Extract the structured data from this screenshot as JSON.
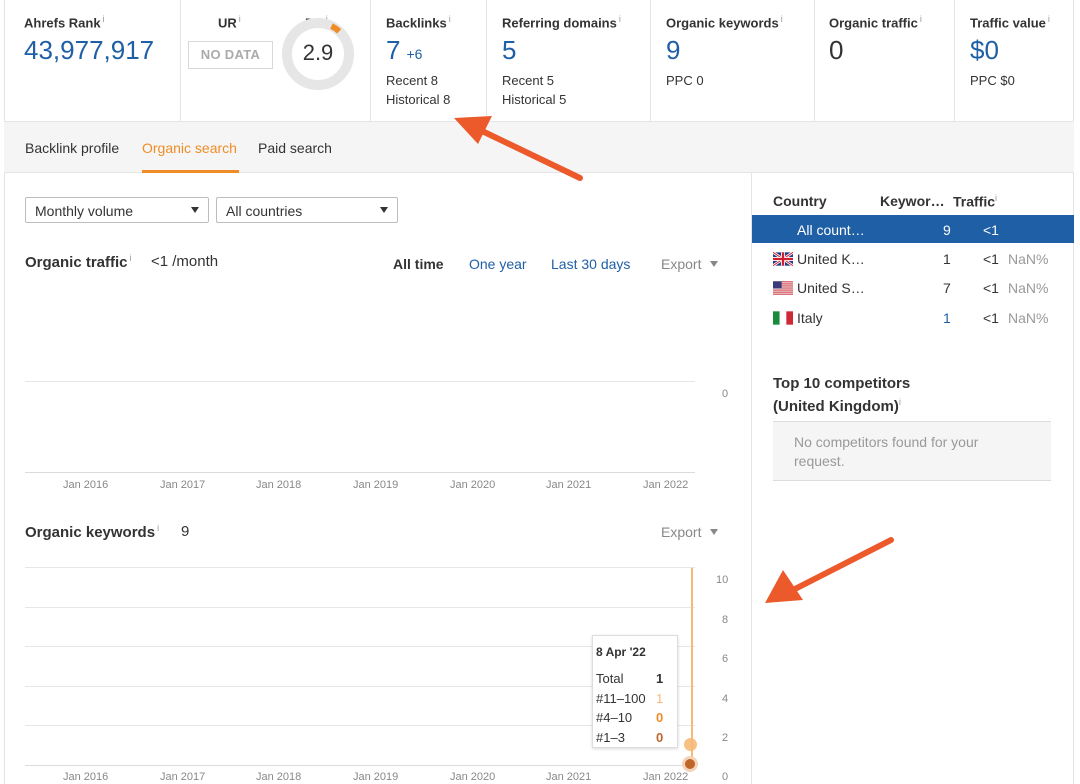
{
  "metrics": {
    "ahrefs_rank": {
      "label": "Ahrefs Rank",
      "value": "43,977,917"
    },
    "ur": {
      "label": "UR",
      "value": "NO DATA"
    },
    "dr": {
      "label": "DR",
      "value": "2.9",
      "fraction": 0.029
    },
    "backlinks": {
      "label": "Backlinks",
      "value": "7",
      "delta": "+6",
      "recent": "Recent 8",
      "historical": "Historical 8"
    },
    "referring_domains": {
      "label": "Referring domains",
      "value": "5",
      "recent": "Recent 5",
      "historical": "Historical 5"
    },
    "organic_keywords": {
      "label": "Organic keywords",
      "value": "9",
      "sub": "PPC 0"
    },
    "organic_traffic": {
      "label": "Organic traffic",
      "value": "0"
    },
    "traffic_value": {
      "label": "Traffic value",
      "value": "$0",
      "sub": "PPC $0"
    },
    "info_mark": "i"
  },
  "tabs": [
    "Backlink profile",
    "Organic search",
    "Paid search"
  ],
  "filters": {
    "volume": "Monthly volume",
    "country": "All countries"
  },
  "organic_traffic_section": {
    "title": "Organic traffic",
    "value": "<1 /month",
    "range_links": [
      "All time",
      "One year",
      "Last 30 days"
    ],
    "export": "Export",
    "y_tick": "0"
  },
  "x_axis_labels": [
    "Jan 2016",
    "Jan 2017",
    "Jan 2018",
    "Jan 2019",
    "Jan 2020",
    "Jan 2021",
    "Jan 2022"
  ],
  "organic_keywords_section": {
    "title": "Organic keywords",
    "value": "9",
    "export": "Export",
    "y_ticks": [
      "10",
      "8",
      "6",
      "4",
      "2",
      "0"
    ]
  },
  "tooltip": {
    "date": "8 Apr '22",
    "rows": [
      {
        "label": "Total",
        "value": "1"
      },
      {
        "label": "#11–100",
        "value": "1"
      },
      {
        "label": "#4–10",
        "value": "0"
      },
      {
        "label": "#1–3",
        "value": "0"
      }
    ]
  },
  "country_table": {
    "headers": {
      "country": "Country",
      "keywords": "Keywor…",
      "traffic": "Traffic"
    },
    "rows": [
      {
        "country": "All count…",
        "keywords": "9",
        "traffic": "<1",
        "pct": "",
        "flag": ""
      },
      {
        "country": "United K…",
        "keywords": "1",
        "traffic": "<1",
        "pct": "NaN%",
        "flag": "uk-flag"
      },
      {
        "country": "United S…",
        "keywords": "7",
        "traffic": "<1",
        "pct": "NaN%",
        "flag": "us-flag"
      },
      {
        "country": "Italy",
        "keywords": "1",
        "traffic": "<1",
        "pct": "NaN%",
        "flag": "it-flag"
      }
    ]
  },
  "competitors": {
    "title_line1": "Top 10 competitors",
    "title_line2": "(United Kingdom)",
    "empty_line1": "No competitors found for your",
    "empty_line2": "request."
  },
  "colors": {
    "accent_blue": "#1f5fa6",
    "accent_orange": "#f08c26",
    "arrow": "#ec5a2c",
    "dot_dark": "#c0652a",
    "dot_light": "#f6b978"
  }
}
